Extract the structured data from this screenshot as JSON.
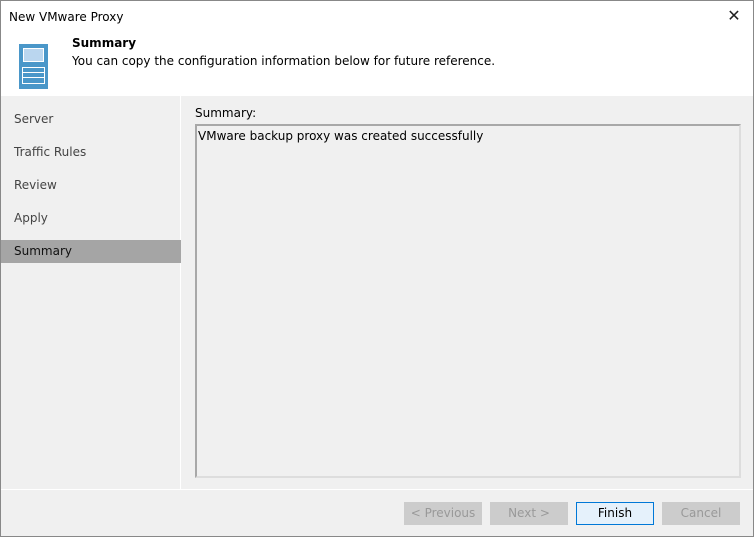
{
  "window": {
    "title": "New VMware Proxy",
    "close": "✕"
  },
  "header": {
    "title": "Summary",
    "description": "You can copy the configuration information below for future reference."
  },
  "steps": [
    {
      "label": "Server"
    },
    {
      "label": "Traffic Rules"
    },
    {
      "label": "Review"
    },
    {
      "label": "Apply"
    },
    {
      "label": "Summary",
      "active": true
    }
  ],
  "summary": {
    "label": "Summary:",
    "text": "VMware backup proxy was created successfully"
  },
  "buttons": {
    "previous": "< Previous",
    "next": "Next >",
    "finish": "Finish",
    "cancel": "Cancel"
  }
}
